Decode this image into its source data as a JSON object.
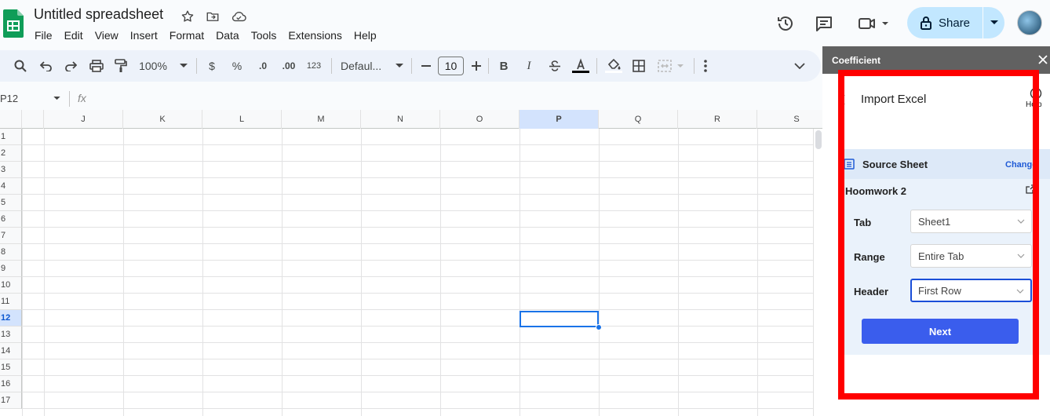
{
  "document": {
    "title": "Untitled spreadsheet",
    "menu": [
      "File",
      "Edit",
      "View",
      "Insert",
      "Format",
      "Data",
      "Tools",
      "Extensions",
      "Help"
    ]
  },
  "header": {
    "share_label": "Share",
    "icons": [
      "history-icon",
      "comment-icon",
      "video-call-icon",
      "lock-icon",
      "avatar"
    ]
  },
  "toolbar": {
    "zoom": "100%",
    "currency": "$",
    "percent": "%",
    "decrease_decimal": ".0",
    "increase_decimal": ".00",
    "number_format": "123",
    "font": "Defaul...",
    "font_size": "10",
    "bold": "B",
    "italic": "I"
  },
  "formula_bar": {
    "cell_ref": "P12",
    "fx": "fx"
  },
  "grid": {
    "columns": [
      "J",
      "K",
      "L",
      "M",
      "N",
      "O",
      "P",
      "Q",
      "R",
      "S"
    ],
    "rows": [
      "1",
      "2",
      "3",
      "4",
      "5",
      "6",
      "7",
      "8",
      "9",
      "10",
      "11",
      "12",
      "13",
      "14",
      "15",
      "16",
      "17"
    ],
    "selected_column": "P",
    "selected_row": "12"
  },
  "panel": {
    "app_name": "Coefficient",
    "title": "Import Excel",
    "help_label": "Help",
    "source_label": "Source Sheet",
    "change_label": "Change",
    "workbook_name": "Hoomwork 2",
    "fields": [
      {
        "label": "Tab",
        "value": "Sheet1"
      },
      {
        "label": "Range",
        "value": "Entire Tab"
      },
      {
        "label": "Header",
        "value": "First Row"
      }
    ],
    "next_label": "Next"
  },
  "colors": {
    "accent": "#1a73e8",
    "share_bg": "#c2e7ff",
    "panel_header": "#616161",
    "next_button": "#3a5ded",
    "highlight": "#ff0000"
  }
}
